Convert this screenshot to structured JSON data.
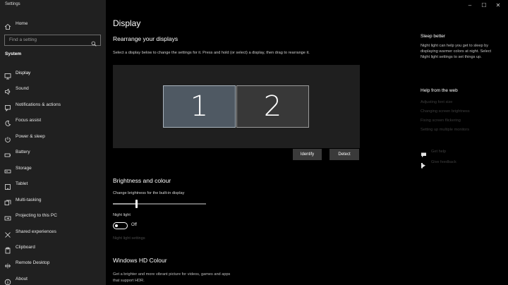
{
  "window": {
    "title": "Settings",
    "minimize_glyph": "–",
    "maximize_glyph": "☐",
    "close_glyph": "✕"
  },
  "sidebar": {
    "home_label": "Home",
    "search_placeholder": "Find a setting",
    "section_label": "System",
    "items": [
      {
        "label": "Display",
        "icon": "display-icon",
        "active": true
      },
      {
        "label": "Sound",
        "icon": "sound-icon"
      },
      {
        "label": "Notifications & actions",
        "icon": "notifications-icon"
      },
      {
        "label": "Focus assist",
        "icon": "focus-assist-icon"
      },
      {
        "label": "Power & sleep",
        "icon": "power-icon"
      },
      {
        "label": "Battery",
        "icon": "battery-icon"
      },
      {
        "label": "Storage",
        "icon": "storage-icon"
      },
      {
        "label": "Tablet",
        "icon": "tablet-icon"
      },
      {
        "label": "Multi-tasking",
        "icon": "multitasking-icon"
      },
      {
        "label": "Projecting to this PC",
        "icon": "projecting-icon"
      },
      {
        "label": "Shared experiences",
        "icon": "shared-experiences-icon"
      },
      {
        "label": "Clipboard",
        "icon": "clipboard-icon"
      },
      {
        "label": "Remote Desktop",
        "icon": "remote-desktop-icon"
      },
      {
        "label": "About",
        "icon": "about-icon"
      }
    ]
  },
  "main": {
    "title": "Display",
    "rearrange": {
      "heading": "Rearrange your displays",
      "instructions": "Select a display below to change the settings for it. Press and hold (or select) a display, then drag to rearrange it.",
      "displays": [
        "1",
        "2"
      ],
      "selected_display": "1",
      "identify_label": "Identify",
      "detect_label": "Detect"
    },
    "brightness": {
      "heading": "Brightness and colour",
      "slider_label": "Change brightness for the built-in display",
      "level_fraction": 0.25,
      "night_light_label": "Night light",
      "night_light_state": "Off",
      "night_light_settings_link": "Night light settings"
    },
    "hdr": {
      "heading": "Windows HD Colour",
      "description_line1": "Get a brighter and more vibrant picture for videos, games and apps",
      "description_line2": "that support HDR."
    }
  },
  "right": {
    "sleep_heading": "Sleep better",
    "sleep_text": "Night light can help you get to sleep by displaying warmer colors at night. Select Night light settings to set things up.",
    "help_heading": "Help from the web",
    "help_links": [
      "Adjusting font size",
      "Changing screen brightness",
      "Fixing screen flickering",
      "Setting up multiple monitors"
    ],
    "get_help": "Get help",
    "give_feedback": "Give feedback"
  },
  "colors": {
    "sidebar_bg": "#202020",
    "selected_display": "#4f5963",
    "other_display": "#383838",
    "dim_link": "#3f3f3f"
  }
}
